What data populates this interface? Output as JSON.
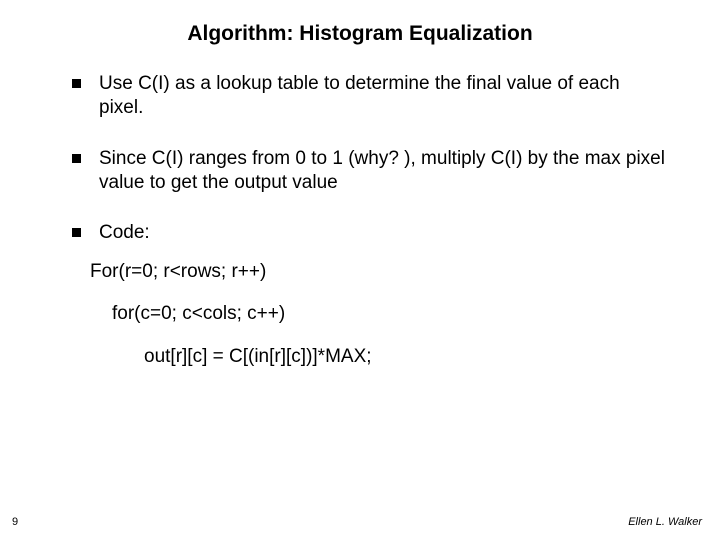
{
  "title": "Algorithm: Histogram Equalization",
  "bullets": [
    "Use C(I) as a lookup table to determine the final value of each pixel.",
    "Since C(I) ranges from 0 to 1 (why? ), multiply C(I) by the max pixel value to get the output value",
    "Code:"
  ],
  "code": {
    "l1": "For(r=0; r<rows; r++)",
    "l2": "for(c=0; c<cols; c++)",
    "l3": "out[r][c] = C[(in[r][c])]*MAX;"
  },
  "page_number": "9",
  "author": "Ellen L. Walker"
}
